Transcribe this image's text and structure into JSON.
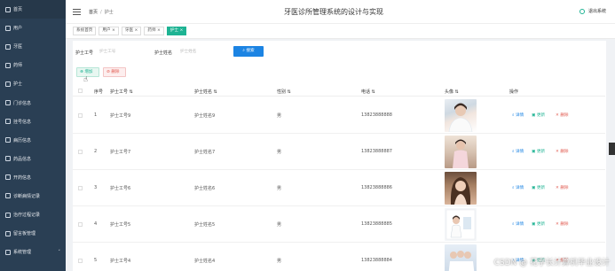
{
  "sidebar": {
    "items": [
      {
        "label": "首页",
        "icon": "home-icon"
      },
      {
        "label": "用户",
        "icon": "user-icon"
      },
      {
        "label": "牙医",
        "icon": "doctor-icon"
      },
      {
        "label": "药师",
        "icon": "pharmacist-icon"
      },
      {
        "label": "护士",
        "icon": "nurse-icon"
      },
      {
        "label": "门诊信息",
        "icon": "clinic-icon"
      },
      {
        "label": "挂号信息",
        "icon": "register-icon"
      },
      {
        "label": "病历信息",
        "icon": "record-icon"
      },
      {
        "label": "药品信息",
        "icon": "drug-icon"
      },
      {
        "label": "开药信息",
        "icon": "prescribe-icon"
      },
      {
        "label": "诊断病情记录",
        "icon": "diagnosis-icon"
      },
      {
        "label": "治疗过程记录",
        "icon": "treatment-icon"
      },
      {
        "label": "留言板管理",
        "icon": "message-icon"
      },
      {
        "label": "系统管理",
        "icon": "system-icon",
        "chevron": "˅"
      }
    ]
  },
  "header": {
    "crumb_home": "首页",
    "crumb_sep": "/",
    "crumb_current": "护士",
    "title": "牙医诊所管理系统的设计与实现",
    "logout": "退出系统"
  },
  "tabs": [
    {
      "label": "系统首页"
    },
    {
      "label": "用户 ×"
    },
    {
      "label": "牙医 ×"
    },
    {
      "label": "药师 ×"
    },
    {
      "label": "护士 ×",
      "active": true
    }
  ],
  "search": {
    "field1_label": "护士工号",
    "field1_placeholder": "护士工号",
    "field2_label": "护士姓名",
    "field2_placeholder": "护士姓名",
    "button": "搜索"
  },
  "toolbar": {
    "add_label": "增加",
    "delete_label": "删除"
  },
  "table": {
    "headers": {
      "index": "序号",
      "no": "护士工号",
      "name": "护士姓名",
      "gender": "性别",
      "phone": "电话",
      "avatar": "头像",
      "ops": "操作"
    },
    "rows": [
      {
        "index": "1",
        "no": "护士工号9",
        "name": "护士姓名9",
        "gender": "男",
        "phone": "13823888888"
      },
      {
        "index": "2",
        "no": "护士工号7",
        "name": "护士姓名7",
        "gender": "男",
        "phone": "13823888887"
      },
      {
        "index": "3",
        "no": "护士工号6",
        "name": "护士姓名6",
        "gender": "男",
        "phone": "13823888886"
      },
      {
        "index": "4",
        "no": "护士工号5",
        "name": "护士姓名5",
        "gender": "男",
        "phone": "13823888885"
      },
      {
        "index": "5",
        "no": "护士工号4",
        "name": "护士姓名4",
        "gender": "男",
        "phone": "13823888884"
      }
    ],
    "actions": {
      "detail": "详情",
      "edit": "更新",
      "delete": "删除"
    }
  },
  "watermark": "CSDN @ 花学长计算机毕业设计",
  "colors": {
    "sidebar": "#2a3f54",
    "accent": "#1eb393",
    "primary": "#1c84e3",
    "danger": "#e0574c"
  }
}
